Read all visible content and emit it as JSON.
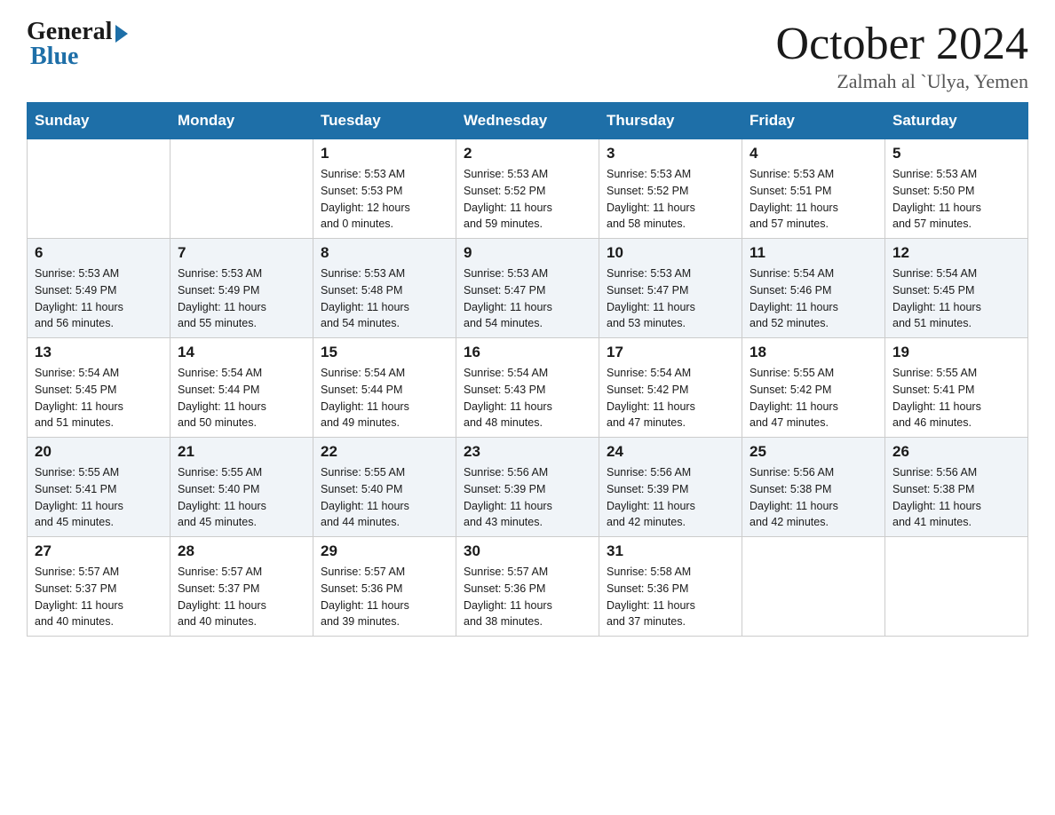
{
  "header": {
    "logo_general": "General",
    "logo_blue": "Blue",
    "month_title": "October 2024",
    "location": "Zalmah al `Ulya, Yemen"
  },
  "days_of_week": [
    "Sunday",
    "Monday",
    "Tuesday",
    "Wednesday",
    "Thursday",
    "Friday",
    "Saturday"
  ],
  "weeks": [
    [
      {
        "day": "",
        "info": ""
      },
      {
        "day": "",
        "info": ""
      },
      {
        "day": "1",
        "info": "Sunrise: 5:53 AM\nSunset: 5:53 PM\nDaylight: 12 hours\nand 0 minutes."
      },
      {
        "day": "2",
        "info": "Sunrise: 5:53 AM\nSunset: 5:52 PM\nDaylight: 11 hours\nand 59 minutes."
      },
      {
        "day": "3",
        "info": "Sunrise: 5:53 AM\nSunset: 5:52 PM\nDaylight: 11 hours\nand 58 minutes."
      },
      {
        "day": "4",
        "info": "Sunrise: 5:53 AM\nSunset: 5:51 PM\nDaylight: 11 hours\nand 57 minutes."
      },
      {
        "day": "5",
        "info": "Sunrise: 5:53 AM\nSunset: 5:50 PM\nDaylight: 11 hours\nand 57 minutes."
      }
    ],
    [
      {
        "day": "6",
        "info": "Sunrise: 5:53 AM\nSunset: 5:49 PM\nDaylight: 11 hours\nand 56 minutes."
      },
      {
        "day": "7",
        "info": "Sunrise: 5:53 AM\nSunset: 5:49 PM\nDaylight: 11 hours\nand 55 minutes."
      },
      {
        "day": "8",
        "info": "Sunrise: 5:53 AM\nSunset: 5:48 PM\nDaylight: 11 hours\nand 54 minutes."
      },
      {
        "day": "9",
        "info": "Sunrise: 5:53 AM\nSunset: 5:47 PM\nDaylight: 11 hours\nand 54 minutes."
      },
      {
        "day": "10",
        "info": "Sunrise: 5:53 AM\nSunset: 5:47 PM\nDaylight: 11 hours\nand 53 minutes."
      },
      {
        "day": "11",
        "info": "Sunrise: 5:54 AM\nSunset: 5:46 PM\nDaylight: 11 hours\nand 52 minutes."
      },
      {
        "day": "12",
        "info": "Sunrise: 5:54 AM\nSunset: 5:45 PM\nDaylight: 11 hours\nand 51 minutes."
      }
    ],
    [
      {
        "day": "13",
        "info": "Sunrise: 5:54 AM\nSunset: 5:45 PM\nDaylight: 11 hours\nand 51 minutes."
      },
      {
        "day": "14",
        "info": "Sunrise: 5:54 AM\nSunset: 5:44 PM\nDaylight: 11 hours\nand 50 minutes."
      },
      {
        "day": "15",
        "info": "Sunrise: 5:54 AM\nSunset: 5:44 PM\nDaylight: 11 hours\nand 49 minutes."
      },
      {
        "day": "16",
        "info": "Sunrise: 5:54 AM\nSunset: 5:43 PM\nDaylight: 11 hours\nand 48 minutes."
      },
      {
        "day": "17",
        "info": "Sunrise: 5:54 AM\nSunset: 5:42 PM\nDaylight: 11 hours\nand 47 minutes."
      },
      {
        "day": "18",
        "info": "Sunrise: 5:55 AM\nSunset: 5:42 PM\nDaylight: 11 hours\nand 47 minutes."
      },
      {
        "day": "19",
        "info": "Sunrise: 5:55 AM\nSunset: 5:41 PM\nDaylight: 11 hours\nand 46 minutes."
      }
    ],
    [
      {
        "day": "20",
        "info": "Sunrise: 5:55 AM\nSunset: 5:41 PM\nDaylight: 11 hours\nand 45 minutes."
      },
      {
        "day": "21",
        "info": "Sunrise: 5:55 AM\nSunset: 5:40 PM\nDaylight: 11 hours\nand 45 minutes."
      },
      {
        "day": "22",
        "info": "Sunrise: 5:55 AM\nSunset: 5:40 PM\nDaylight: 11 hours\nand 44 minutes."
      },
      {
        "day": "23",
        "info": "Sunrise: 5:56 AM\nSunset: 5:39 PM\nDaylight: 11 hours\nand 43 minutes."
      },
      {
        "day": "24",
        "info": "Sunrise: 5:56 AM\nSunset: 5:39 PM\nDaylight: 11 hours\nand 42 minutes."
      },
      {
        "day": "25",
        "info": "Sunrise: 5:56 AM\nSunset: 5:38 PM\nDaylight: 11 hours\nand 42 minutes."
      },
      {
        "day": "26",
        "info": "Sunrise: 5:56 AM\nSunset: 5:38 PM\nDaylight: 11 hours\nand 41 minutes."
      }
    ],
    [
      {
        "day": "27",
        "info": "Sunrise: 5:57 AM\nSunset: 5:37 PM\nDaylight: 11 hours\nand 40 minutes."
      },
      {
        "day": "28",
        "info": "Sunrise: 5:57 AM\nSunset: 5:37 PM\nDaylight: 11 hours\nand 40 minutes."
      },
      {
        "day": "29",
        "info": "Sunrise: 5:57 AM\nSunset: 5:36 PM\nDaylight: 11 hours\nand 39 minutes."
      },
      {
        "day": "30",
        "info": "Sunrise: 5:57 AM\nSunset: 5:36 PM\nDaylight: 11 hours\nand 38 minutes."
      },
      {
        "day": "31",
        "info": "Sunrise: 5:58 AM\nSunset: 5:36 PM\nDaylight: 11 hours\nand 37 minutes."
      },
      {
        "day": "",
        "info": ""
      },
      {
        "day": "",
        "info": ""
      }
    ]
  ]
}
